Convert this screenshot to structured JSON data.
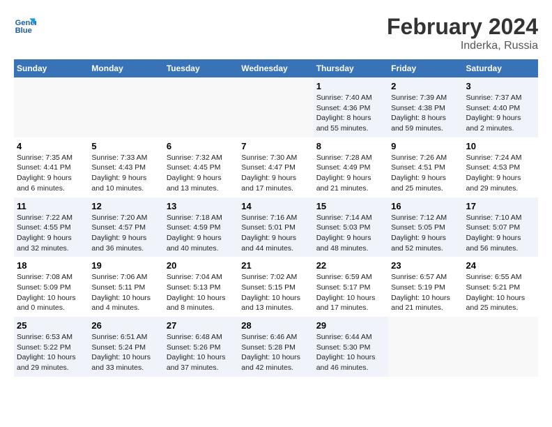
{
  "header": {
    "logo_line1": "General",
    "logo_line2": "Blue",
    "title": "February 2024",
    "subtitle": "Inderka, Russia"
  },
  "days_of_week": [
    "Sunday",
    "Monday",
    "Tuesday",
    "Wednesday",
    "Thursday",
    "Friday",
    "Saturday"
  ],
  "weeks": [
    [
      {
        "day": "",
        "info": ""
      },
      {
        "day": "",
        "info": ""
      },
      {
        "day": "",
        "info": ""
      },
      {
        "day": "",
        "info": ""
      },
      {
        "day": "1",
        "info": "Sunrise: 7:40 AM\nSunset: 4:36 PM\nDaylight: 8 hours\nand 55 minutes."
      },
      {
        "day": "2",
        "info": "Sunrise: 7:39 AM\nSunset: 4:38 PM\nDaylight: 8 hours\nand 59 minutes."
      },
      {
        "day": "3",
        "info": "Sunrise: 7:37 AM\nSunset: 4:40 PM\nDaylight: 9 hours\nand 2 minutes."
      }
    ],
    [
      {
        "day": "4",
        "info": "Sunrise: 7:35 AM\nSunset: 4:41 PM\nDaylight: 9 hours\nand 6 minutes."
      },
      {
        "day": "5",
        "info": "Sunrise: 7:33 AM\nSunset: 4:43 PM\nDaylight: 9 hours\nand 10 minutes."
      },
      {
        "day": "6",
        "info": "Sunrise: 7:32 AM\nSunset: 4:45 PM\nDaylight: 9 hours\nand 13 minutes."
      },
      {
        "day": "7",
        "info": "Sunrise: 7:30 AM\nSunset: 4:47 PM\nDaylight: 9 hours\nand 17 minutes."
      },
      {
        "day": "8",
        "info": "Sunrise: 7:28 AM\nSunset: 4:49 PM\nDaylight: 9 hours\nand 21 minutes."
      },
      {
        "day": "9",
        "info": "Sunrise: 7:26 AM\nSunset: 4:51 PM\nDaylight: 9 hours\nand 25 minutes."
      },
      {
        "day": "10",
        "info": "Sunrise: 7:24 AM\nSunset: 4:53 PM\nDaylight: 9 hours\nand 29 minutes."
      }
    ],
    [
      {
        "day": "11",
        "info": "Sunrise: 7:22 AM\nSunset: 4:55 PM\nDaylight: 9 hours\nand 32 minutes."
      },
      {
        "day": "12",
        "info": "Sunrise: 7:20 AM\nSunset: 4:57 PM\nDaylight: 9 hours\nand 36 minutes."
      },
      {
        "day": "13",
        "info": "Sunrise: 7:18 AM\nSunset: 4:59 PM\nDaylight: 9 hours\nand 40 minutes."
      },
      {
        "day": "14",
        "info": "Sunrise: 7:16 AM\nSunset: 5:01 PM\nDaylight: 9 hours\nand 44 minutes."
      },
      {
        "day": "15",
        "info": "Sunrise: 7:14 AM\nSunset: 5:03 PM\nDaylight: 9 hours\nand 48 minutes."
      },
      {
        "day": "16",
        "info": "Sunrise: 7:12 AM\nSunset: 5:05 PM\nDaylight: 9 hours\nand 52 minutes."
      },
      {
        "day": "17",
        "info": "Sunrise: 7:10 AM\nSunset: 5:07 PM\nDaylight: 9 hours\nand 56 minutes."
      }
    ],
    [
      {
        "day": "18",
        "info": "Sunrise: 7:08 AM\nSunset: 5:09 PM\nDaylight: 10 hours\nand 0 minutes."
      },
      {
        "day": "19",
        "info": "Sunrise: 7:06 AM\nSunset: 5:11 PM\nDaylight: 10 hours\nand 4 minutes."
      },
      {
        "day": "20",
        "info": "Sunrise: 7:04 AM\nSunset: 5:13 PM\nDaylight: 10 hours\nand 8 minutes."
      },
      {
        "day": "21",
        "info": "Sunrise: 7:02 AM\nSunset: 5:15 PM\nDaylight: 10 hours\nand 13 minutes."
      },
      {
        "day": "22",
        "info": "Sunrise: 6:59 AM\nSunset: 5:17 PM\nDaylight: 10 hours\nand 17 minutes."
      },
      {
        "day": "23",
        "info": "Sunrise: 6:57 AM\nSunset: 5:19 PM\nDaylight: 10 hours\nand 21 minutes."
      },
      {
        "day": "24",
        "info": "Sunrise: 6:55 AM\nSunset: 5:21 PM\nDaylight: 10 hours\nand 25 minutes."
      }
    ],
    [
      {
        "day": "25",
        "info": "Sunrise: 6:53 AM\nSunset: 5:22 PM\nDaylight: 10 hours\nand 29 minutes."
      },
      {
        "day": "26",
        "info": "Sunrise: 6:51 AM\nSunset: 5:24 PM\nDaylight: 10 hours\nand 33 minutes."
      },
      {
        "day": "27",
        "info": "Sunrise: 6:48 AM\nSunset: 5:26 PM\nDaylight: 10 hours\nand 37 minutes."
      },
      {
        "day": "28",
        "info": "Sunrise: 6:46 AM\nSunset: 5:28 PM\nDaylight: 10 hours\nand 42 minutes."
      },
      {
        "day": "29",
        "info": "Sunrise: 6:44 AM\nSunset: 5:30 PM\nDaylight: 10 hours\nand 46 minutes."
      },
      {
        "day": "",
        "info": ""
      },
      {
        "day": "",
        "info": ""
      }
    ]
  ]
}
